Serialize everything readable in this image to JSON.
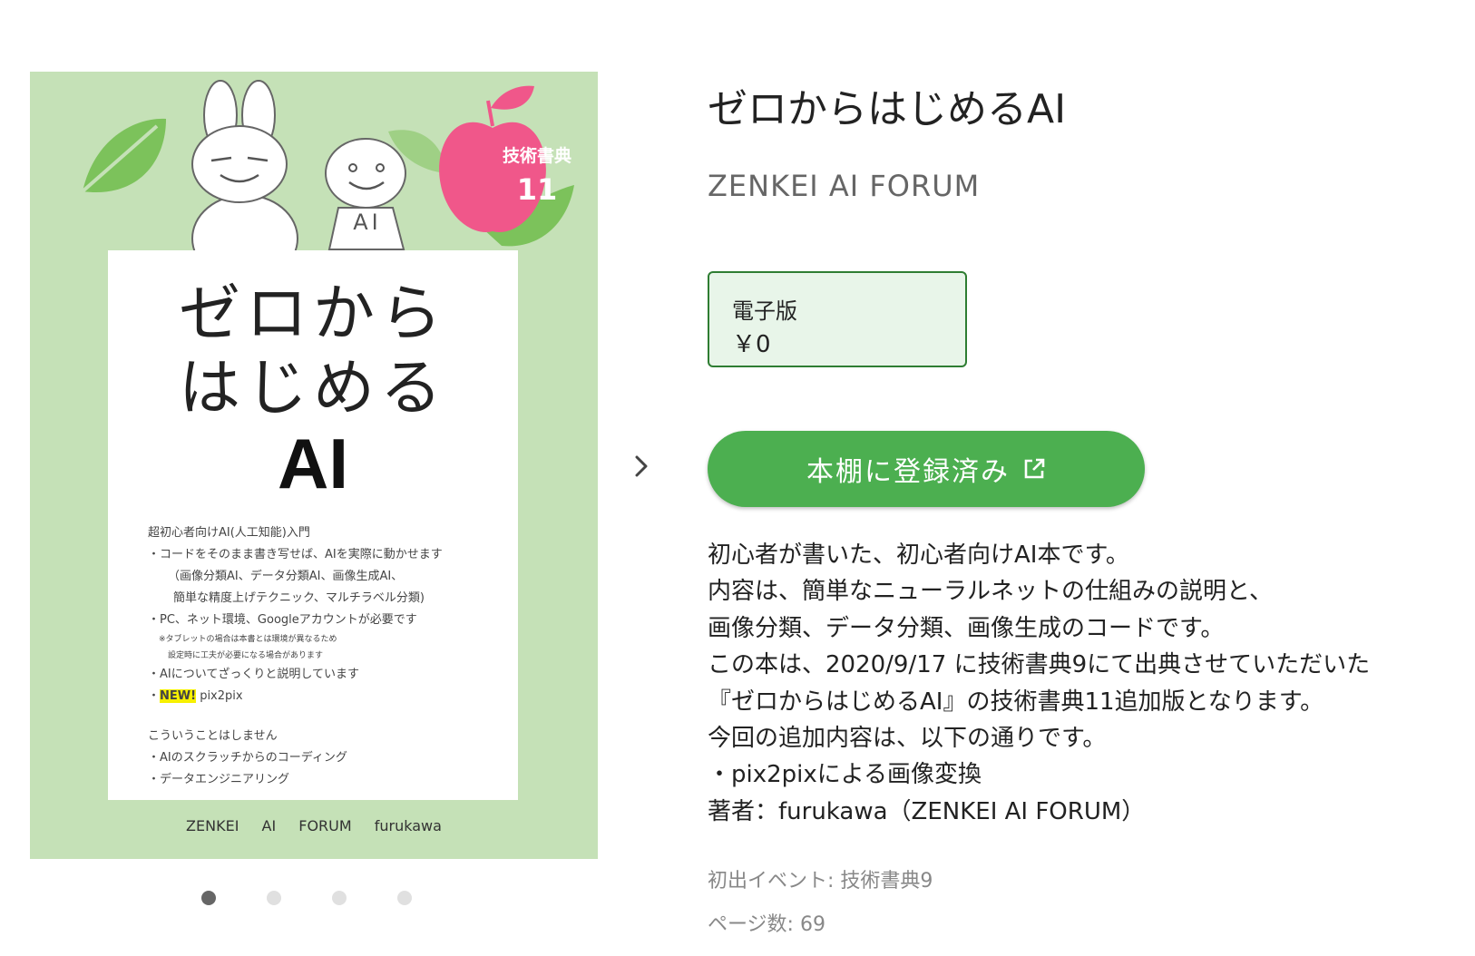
{
  "cover": {
    "badge_line1": "技術書典",
    "badge_line2": "11",
    "robot_label": "AI",
    "title_line1": "ゼロから",
    "title_line2": "はじめる",
    "title_line3": "AI",
    "lines": [
      "超初心者向けAI(人工知能)入門",
      "・コードをそのまま書き写せば、AIを実際に動かせます",
      "（画像分類AI、データ分類AI、画像生成AI、",
      "簡単な精度上げテクニック、マルチラベル分類)",
      "・PC、ネット環境、Googleアカウントが必要です",
      "※タブレットの場合は本書とは環境が異なるため",
      "設定時に工夫が必要になる場合があります",
      "・AIについてざっくりと説明しています"
    ],
    "new_badge": "NEW!",
    "new_item": "pix2pix",
    "not_heading": "こういうことはしません",
    "not_lines": [
      "・AIのスクラッチからのコーディング",
      "・データエンジニアリング"
    ],
    "footer": "ZENKEI AI FORUM furukawa",
    "colors": {
      "background": "#c5e1b7",
      "apple": "#f0578a",
      "leaf": "#7cc25b"
    }
  },
  "carousel": {
    "count": 4,
    "active": 0
  },
  "book": {
    "title": "ゼロからはじめるAI",
    "circle": "ZENKEI AI FORUM"
  },
  "format": {
    "label": "電子版",
    "price": "￥0"
  },
  "shelf_button": {
    "label": "本棚に登録済み",
    "icon": "external-link-icon",
    "color": "#4caf50"
  },
  "description": [
    "初心者が書いた、初心者向けAI本です。",
    "内容は、簡単なニューラルネットの仕組みの説明と、",
    "画像分類、データ分類、画像生成のコードです。",
    "この本は、2020/9/17 に技術書典9にて出典させていただいた",
    "『ゼロからはじめるAI』の技術書典11追加版となります。",
    "今回の追加内容は、以下の通りです。",
    "・pix2pixによる画像変換",
    "著者：furukawa（ZENKEI AI FORUM）"
  ],
  "meta": {
    "first_event": "初出イベント: 技術書典9",
    "pages": "ページ数: 69"
  }
}
